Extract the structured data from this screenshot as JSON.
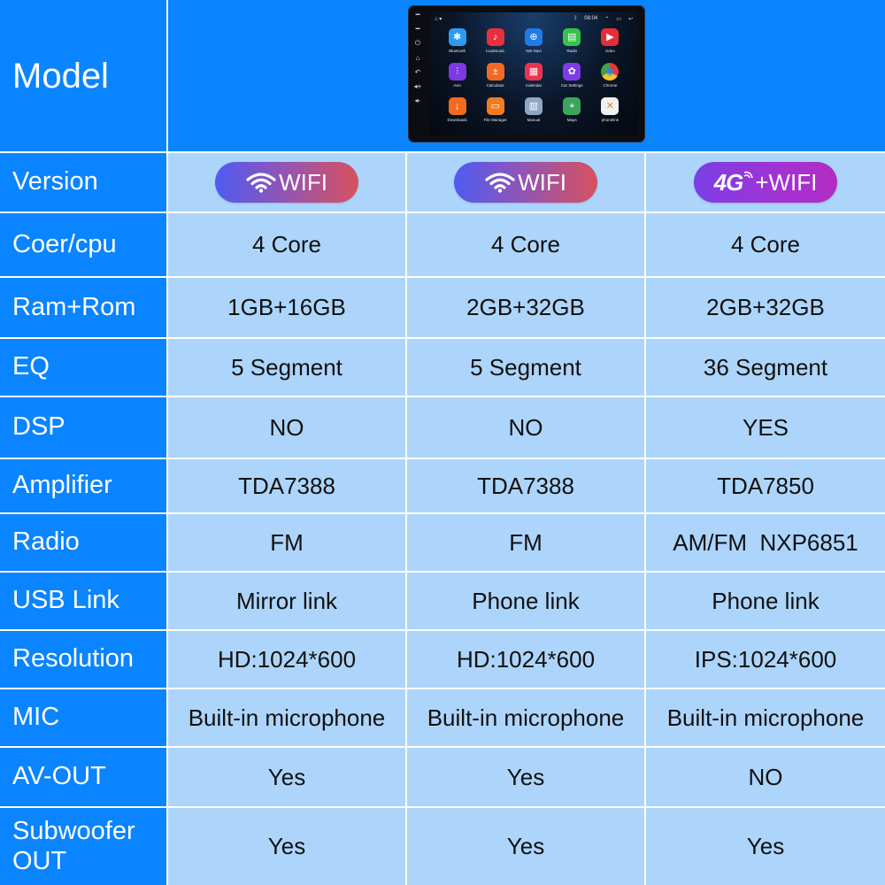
{
  "table": {
    "model_label": "Model",
    "colors": {
      "header_blue": "#0A84FF",
      "cell_light_blue": "#ADD5FB",
      "grid_line": "#FFFFFF"
    },
    "device_preview": {
      "status_time": "08:04",
      "apps": [
        {
          "label": "Bluetooth",
          "icon": "bluetooth-icon",
          "color": "#2E9BF0",
          "glyph": "✱"
        },
        {
          "label": "localmusic",
          "icon": "music-note-icon",
          "color": "#E8303F",
          "glyph": "♪"
        },
        {
          "label": "Net Navi",
          "icon": "navigation-icon",
          "color": "#1E7BE8",
          "glyph": "⊕"
        },
        {
          "label": "Radio",
          "icon": "radio-icon",
          "color": "#34C34A",
          "glyph": "▤"
        },
        {
          "label": "video",
          "icon": "video-play-icon",
          "color": "#E62E3A",
          "glyph": "▶"
        },
        {
          "label": "Avin",
          "icon": "equalizer-icon",
          "color": "#7B3BE0",
          "glyph": "⫶"
        },
        {
          "label": "Calculator",
          "icon": "calculator-icon",
          "color": "#F06A25",
          "glyph": "±"
        },
        {
          "label": "Calendar",
          "icon": "calendar-icon",
          "color": "#E8344F",
          "glyph": "▦"
        },
        {
          "label": "Car Settings",
          "icon": "gear-icon",
          "color": "#7E3CE6",
          "glyph": "✿"
        },
        {
          "label": "Chrome",
          "icon": "chrome-icon",
          "color": "#F2C21B",
          "glyph": "◉"
        },
        {
          "label": "Downloads",
          "icon": "download-icon",
          "color": "#F26B1D",
          "glyph": "↓"
        },
        {
          "label": "File Manager",
          "icon": "folder-icon",
          "color": "#F27A1F",
          "glyph": "▭"
        },
        {
          "label": "Manual",
          "icon": "book-icon",
          "color": "#8FA6C4",
          "glyph": "▥"
        },
        {
          "label": "Maps",
          "icon": "maps-icon",
          "color": "#3BA55C",
          "glyph": "⌖"
        },
        {
          "label": "phonelink",
          "icon": "phonelink-icon",
          "color": "#F1F1F1",
          "glyph": "✕"
        }
      ]
    },
    "rows": [
      {
        "label": "Version",
        "type": "badge",
        "values": [
          {
            "text": "WIFI",
            "variant": "wifi"
          },
          {
            "text": "WIFI",
            "variant": "wifi"
          },
          {
            "prefix": "4G",
            "text": "+WIFI",
            "variant": "fourg"
          }
        ]
      },
      {
        "label": "Coer/cpu",
        "values": [
          "4 Core",
          "4 Core",
          "4 Core"
        ]
      },
      {
        "label": "Ram+Rom",
        "values": [
          "1GB+16GB",
          "2GB+32GB",
          "2GB+32GB"
        ]
      },
      {
        "label": "EQ",
        "values": [
          "5 Segment",
          "5 Segment",
          "36 Segment"
        ]
      },
      {
        "label": "DSP",
        "values": [
          "NO",
          "NO",
          "YES"
        ]
      },
      {
        "label": "Amplifier",
        "values": [
          "TDA7388",
          "TDA7388",
          "TDA7850"
        ]
      },
      {
        "label": "Radio",
        "values": [
          "FM",
          "FM",
          "AM/FM  NXP6851"
        ]
      },
      {
        "label": "USB Link",
        "values": [
          "Mirror link",
          "Phone link",
          "Phone link"
        ]
      },
      {
        "label": "Resolution",
        "values": [
          "HD:1024*600",
          "HD:1024*600",
          "IPS:1024*600"
        ]
      },
      {
        "label": "MIC",
        "values": [
          "Built-in microphone",
          "Built-in microphone",
          "Built-in microphone"
        ]
      },
      {
        "label": "AV-OUT",
        "values": [
          "Yes",
          "Yes",
          "NO"
        ]
      },
      {
        "label": "Subwoofer\nOUT",
        "values": [
          "Yes",
          "Yes",
          "Yes"
        ]
      }
    ]
  }
}
